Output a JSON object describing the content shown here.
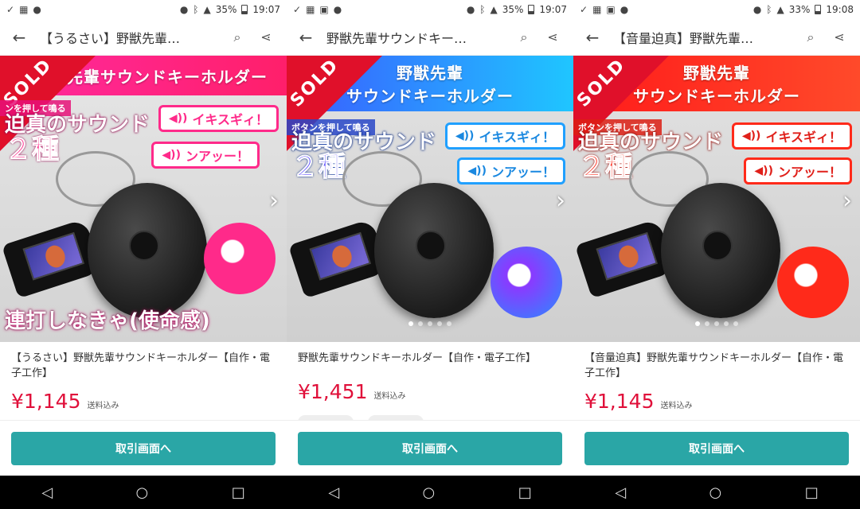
{
  "colors": {
    "price": "#e0103a",
    "cta": "#2aa6a6",
    "sold": "#e0102a",
    "pink": "#ff2a8a",
    "blue": "#20a0ff",
    "red": "#ff2a1a"
  },
  "screens": [
    {
      "status": {
        "battery": "35%",
        "time": "19:07"
      },
      "title": "【うるさい】野獣先輩…",
      "banner": {
        "line1": "先輩サウンドキーホルダー",
        "line2": ""
      },
      "sold": "SOLD",
      "subline": "ンを押して鳴る",
      "headline1": "迫真のサウンド",
      "headline2": "２種",
      "pill1": "イキスギィ！",
      "pill2": "ンアッー！",
      "bottom_text": "連打しなきゃ(使命感)",
      "item_name": "【うるさい】野獣先輩サウンドキーホルダー【自作・電子工作】",
      "price": "¥1,145",
      "shipping": "送料込み",
      "cta": "取引画面へ"
    },
    {
      "status": {
        "battery": "35%",
        "time": "19:07"
      },
      "title": "野獣先輩サウンドキー…",
      "banner": {
        "line1": "野獣先輩",
        "line2": "サウンドキーホルダー"
      },
      "sold": "SOLD",
      "subline": "ボタンを押して鳴る",
      "headline1": "迫真のサウンド",
      "headline2": "２種",
      "pill1": "イキスギィ！",
      "pill2": "ンアッー！",
      "bottom_text": "",
      "item_name": "野獣先輩サウンドキーホルダー【自作・電子工作】",
      "price": "¥1,451",
      "shipping": "送料込み",
      "cta": "取引画面へ"
    },
    {
      "status": {
        "battery": "33%",
        "time": "19:08"
      },
      "title": "【音量迫真】野獣先輩…",
      "banner": {
        "line1": "野獣先輩",
        "line2": "サウンドキーホルダー"
      },
      "sold": "SOLD",
      "subline": "ボタンを押して鳴る",
      "headline1": "迫真のサウンド",
      "headline2": "２種",
      "pill1": "イキスギィ！",
      "pill2": "ンアッー！",
      "bottom_text": "",
      "item_name": "【音量迫真】野獣先輩サウンドキーホルダー【自作・電子工作】",
      "price": "¥1,145",
      "shipping": "送料込み",
      "cta": "取引画面へ"
    }
  ],
  "icons": {
    "back": "arrow-left-icon",
    "search": "search-icon",
    "share": "share-icon",
    "nav_back": "triangle-back-icon",
    "nav_home": "circle-home-icon",
    "nav_recent": "square-recent-icon"
  }
}
